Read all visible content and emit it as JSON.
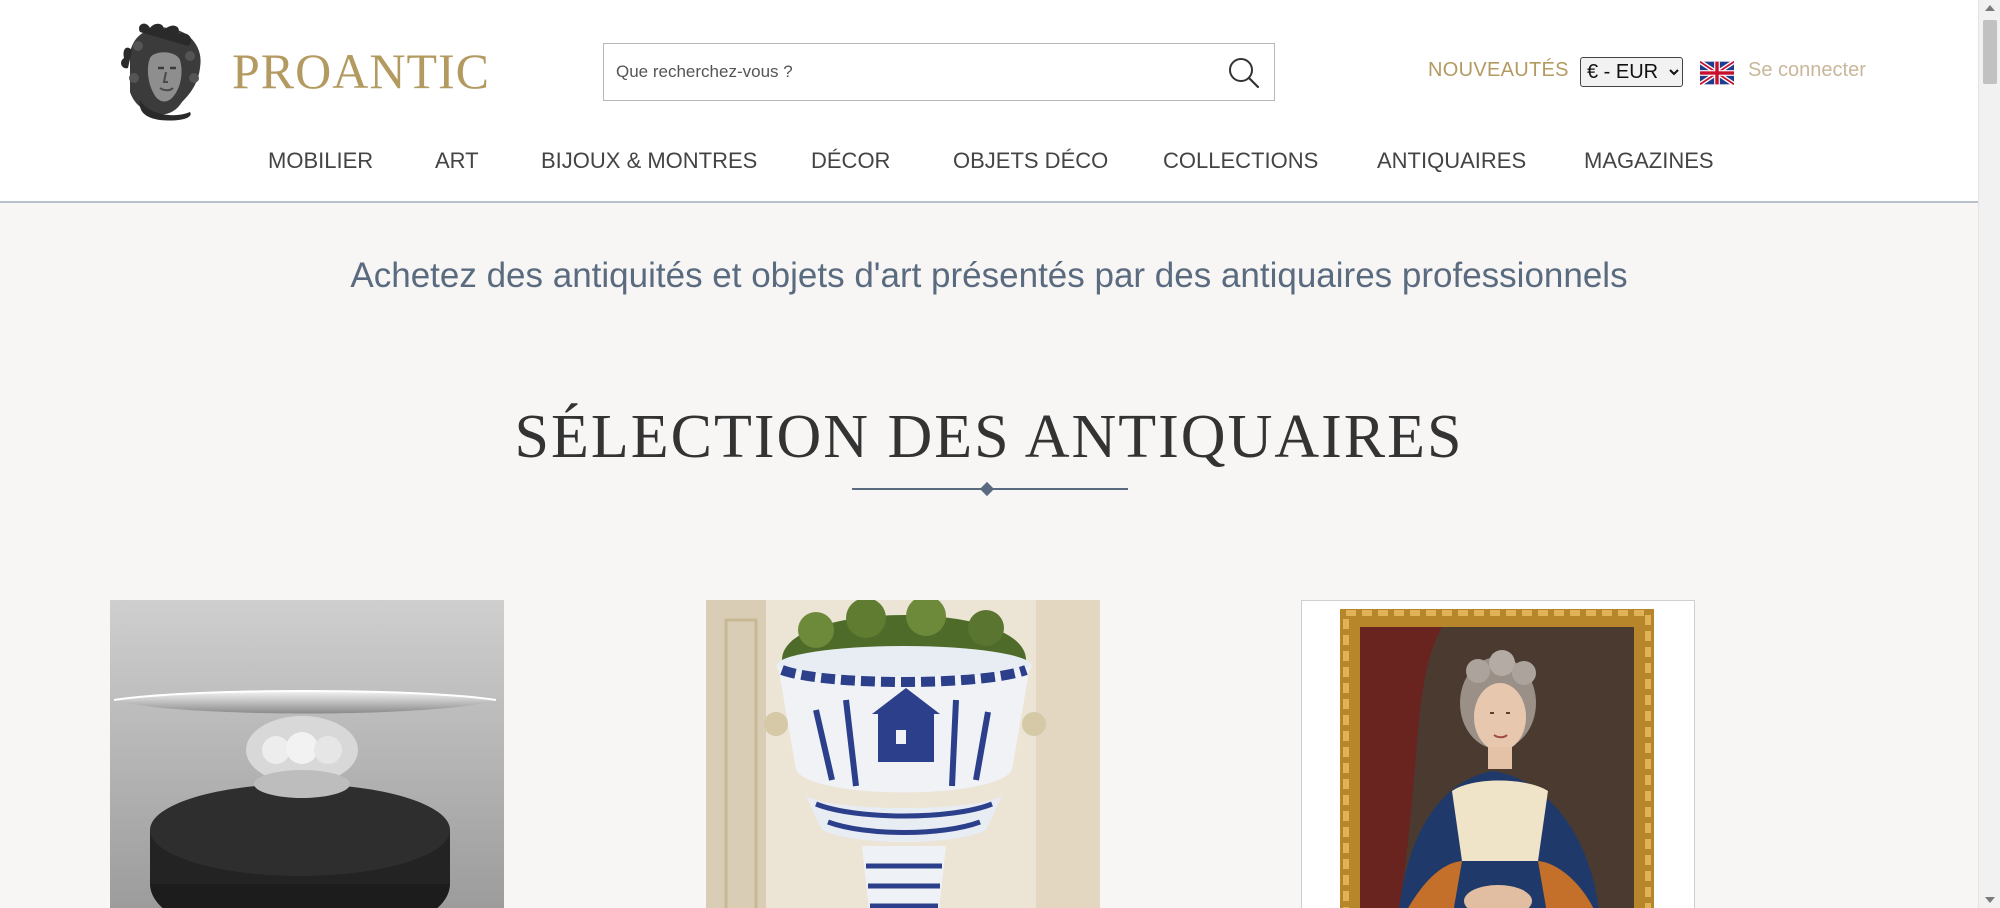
{
  "header": {
    "logo_text": "PROANTIC",
    "search_placeholder": "Que recherchez-vous ?",
    "new_label": "NOUVEAUTÉS",
    "currency": {
      "selected": "€ - EUR",
      "options": [
        "€ - EUR"
      ]
    },
    "language_flag": "uk-flag-icon",
    "login_label": "Se connecter"
  },
  "nav": {
    "items": [
      {
        "label": "MOBILIER"
      },
      {
        "label": "ART"
      },
      {
        "label": "BIJOUX & MONTRES"
      },
      {
        "label": "DÉCOR"
      },
      {
        "label": "OBJETS DÉCO"
      },
      {
        "label": "COLLECTIONS"
      },
      {
        "label": "ANTIQUAIRES"
      },
      {
        "label": "MAGAZINES"
      }
    ]
  },
  "main": {
    "tagline": "Achetez des antiquités et objets d'art présentés par des antiquaires professionnels",
    "section_title": "SÉLECTION DES ANTIQUAIRES"
  },
  "colors": {
    "brand_gold": "#b39a61",
    "accent_slate": "#5a6b80",
    "background": "#f7f6f4"
  }
}
